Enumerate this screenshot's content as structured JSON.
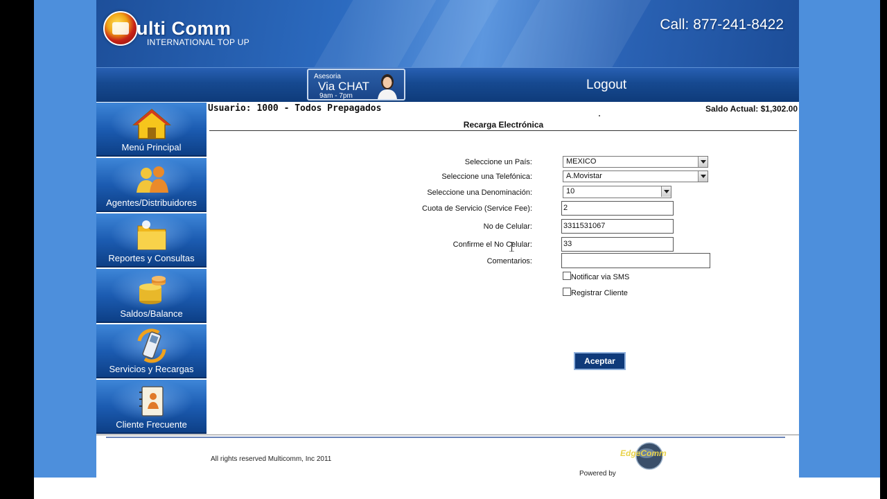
{
  "header": {
    "logo_text": "ulti Comm",
    "logo_subtitle": "INTERNATIONAL TOP UP",
    "phone": "Call: 877-241-8422"
  },
  "navbar": {
    "chat_line1": "Asesoria",
    "chat_line2": "Via CHAT",
    "chat_line3": "9am - 7pm",
    "logout": "Logout"
  },
  "sidebar": {
    "items": [
      {
        "label": "Menú Principal",
        "icon": "home-icon"
      },
      {
        "label": "Agentes/Distribuidores",
        "icon": "users-icon"
      },
      {
        "label": "Reportes y Consultas",
        "icon": "folder-icon"
      },
      {
        "label": "Saldos/Balance",
        "icon": "coins-icon"
      },
      {
        "label": "Servicios y Recargas",
        "icon": "phone-refresh-icon"
      },
      {
        "label": "Cliente Frecuente",
        "icon": "contact-book-icon"
      }
    ]
  },
  "content": {
    "user_line": "Usuario: 1000 - Todos Prepagados",
    "saldo": "Saldo Actual: $1,302.00",
    "title": "Recarga Electrónica"
  },
  "form": {
    "pais_label": "Seleccione un País:",
    "pais_value": "MEXICO",
    "telefonica_label": "Seleccione una Telefónica:",
    "telefonica_value": "A.Movistar",
    "denominacion_label": "Seleccione una Denominación:",
    "denominacion_value": "10",
    "cuota_label": "Cuota de Servicio (Service Fee):",
    "cuota_value": "2",
    "celular_label": "No de Celular:",
    "celular_value": "3311531067",
    "confirme_label": "Confirme el No Celular:",
    "confirme_value": "33",
    "comentarios_label": "Comentarios:",
    "comentarios_value": "",
    "sms_label": "Notificar via SMS",
    "registrar_label": "Registrar Cliente",
    "submit": "Aceptar"
  },
  "footer": {
    "copyright": "All rights reserved Multicomm, Inc 2011",
    "powered_by": "Powered by",
    "partner_logo": "EdgeComm"
  }
}
